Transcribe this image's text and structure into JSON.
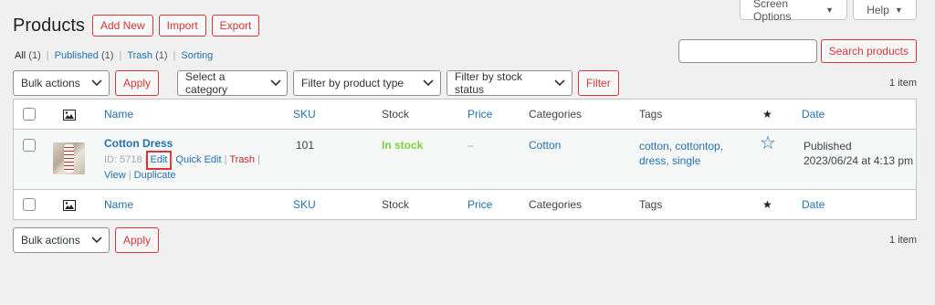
{
  "screen_meta": {
    "screen_options_label": "Screen Options",
    "help_label": "Help"
  },
  "header": {
    "title": "Products",
    "add_new": "Add New",
    "import": "Import",
    "export": "Export"
  },
  "views": [
    {
      "label": "All",
      "count": "(1)",
      "current": true
    },
    {
      "label": "Published",
      "count": "(1)"
    },
    {
      "label": "Trash",
      "count": "(1)"
    },
    {
      "label": "Sorting",
      "count": ""
    }
  ],
  "search": {
    "placeholder": "",
    "button": "Search products"
  },
  "tablenav_top": {
    "bulk_actions": "Bulk actions",
    "apply": "Apply",
    "category_filter": "Select a category",
    "type_filter": "Filter by product type",
    "stock_filter": "Filter by stock status",
    "filter_button": "Filter",
    "items_count": "1 item"
  },
  "tablenav_bottom": {
    "bulk_actions": "Bulk actions",
    "apply": "Apply",
    "items_count": "1 item"
  },
  "columns": {
    "name": "Name",
    "sku": "SKU",
    "stock": "Stock",
    "price": "Price",
    "categories": "Categories",
    "tags": "Tags",
    "featured": "★",
    "date": "Date"
  },
  "product": {
    "name": "Cotton Dress",
    "id_label": "ID: 5718",
    "actions": {
      "edit": "Edit",
      "quick_edit": "Quick Edit",
      "trash": "Trash",
      "view": "View",
      "duplicate": "Duplicate"
    },
    "sku": "101",
    "stock": "In stock",
    "price": "–",
    "category": "Cotton",
    "tags_line1": "cotton, cottontop,",
    "tags_line2": "dress, single",
    "featured": "☆",
    "status": "Published",
    "date": "2023/06/24 at 4:13 pm"
  }
}
